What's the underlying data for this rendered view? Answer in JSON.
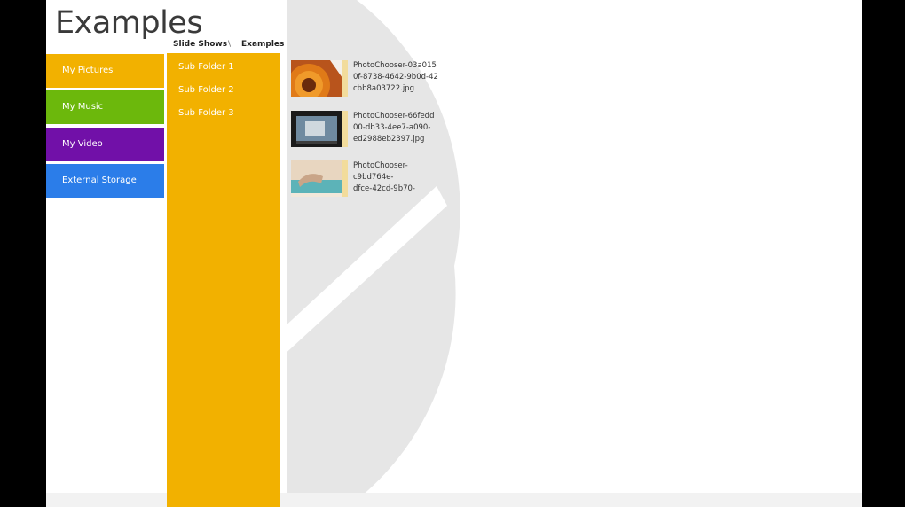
{
  "page": {
    "title": "Examples"
  },
  "breadcrumb": {
    "items": [
      "Slide Shows",
      "Examples"
    ],
    "separator": "\\"
  },
  "nav": {
    "items": [
      {
        "label": "My Pictures",
        "color": "#f2b100"
      },
      {
        "label": "My Music",
        "color": "#6cb80c"
      },
      {
        "label": "My Video",
        "color": "#7110a8"
      },
      {
        "label": "External Storage",
        "color": "#2b7de9"
      }
    ]
  },
  "folders": {
    "color": "#f2b100",
    "items": [
      "Sub Folder 1",
      "Sub Folder 2",
      "Sub Folder 3"
    ]
  },
  "files": [
    {
      "lines": [
        "PhotoChooser-03a015",
        "0f-8738-4642-9b0d-42",
        "cbb8a03722.jpg"
      ],
      "thumb": "flower-thumbnail"
    },
    {
      "lines": [
        "PhotoChooser-66fedd",
        "00-db33-4ee7-a090-",
        "ed2988eb2397.jpg"
      ],
      "thumb": "video-thumbnail"
    },
    {
      "lines": [
        "PhotoChooser-",
        "c9bd764e-",
        "dfce-42cd-9b70-"
      ],
      "thumb": "pool-thumbnail"
    }
  ],
  "colors": {
    "background_art": "#e6e6e6",
    "folder_strip": "#f2dc9c"
  }
}
